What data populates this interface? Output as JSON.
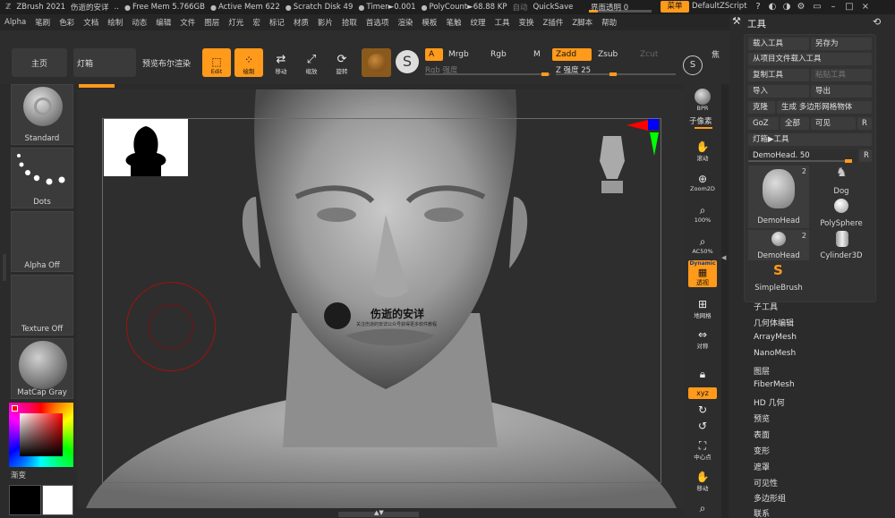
{
  "titlebar": {
    "app": "ZBrush 2021",
    "doc": "伤逝的安详",
    "ellipsis": "..",
    "free_mem": "Free Mem 5.766GB",
    "active_mem": "Active Mem 622",
    "scratch": "Scratch Disk 49",
    "timer": "Timer►0.001",
    "polycount": "PolyCount►68.88 KP",
    "auto": "自动",
    "quicksave": "QuickSave",
    "ui_transparency": "界面透明 0",
    "menu_btn": "菜单",
    "script": "DefaultZScript"
  },
  "menus": [
    "Alpha",
    "笔刷",
    "色彩",
    "文档",
    "绘制",
    "动态",
    "编辑",
    "文件",
    "图层",
    "灯光",
    "宏",
    "标记",
    "材质",
    "影片",
    "拾取",
    "首选项",
    "渲染",
    "模板",
    "笔触",
    "纹理",
    "工具",
    "变换",
    "Z插件",
    "Z脚本",
    "帮助"
  ],
  "toolbar": {
    "home": "主页",
    "lightbox": "灯箱",
    "bpr": "预览布尔渲染",
    "edit": "Edit",
    "draw": "绘制",
    "move": "移动",
    "scale": "缩放",
    "rotate": "旋转",
    "a": "A",
    "mrgb": "Mrgb",
    "rgb": "Rgb",
    "m": "M",
    "rgb_intensity": "Rgb 强度",
    "zadd": "Zadd",
    "zsub": "Zsub",
    "zcut": "Zcut",
    "z_intensity": "Z 强度 25",
    "focal": "焦"
  },
  "left_shelf": {
    "brush": "Standard",
    "stroke": "Dots",
    "alpha": "Alpha Off",
    "texture": "Texture Off",
    "material": "MatCap Gray",
    "gradient": "渐变"
  },
  "right_col": {
    "bpr": "BPR",
    "subpixel": "子像素",
    "scroll": "滚动",
    "zoom2d": "Zoom2D",
    "actual": "100%",
    "half": "AC50%",
    "dynamic": "Dynamic",
    "persp": "透视",
    "floor": "地网格",
    "local": "对称",
    "xyz": "xyz",
    "frame": "中心点",
    "move": "移动"
  },
  "watermark": {
    "title": "伤逝的安详",
    "sub": "关注伤逝的安详公众号获得更多软件教程"
  },
  "panel": {
    "title": "工具",
    "buttons": {
      "load": "载入工具",
      "save_as": "另存为",
      "load_from_project": "从项目文件载入工具",
      "copy": "复制工具",
      "paste": "粘贴工具",
      "import": "导入",
      "export": "导出",
      "clone": "克隆",
      "make_polymesh": "生成 多边形网格物体",
      "goz": "GoZ",
      "all": "全部",
      "visible": "可见",
      "r": "R",
      "lightbox_tools": "灯箱▶工具",
      "current_tool": "DemoHead. 50"
    },
    "tiles": {
      "demohead1": "DemoHead",
      "dog": "Dog",
      "polysphere": "PolySphere",
      "demohead2": "DemoHead",
      "cylinder": "Cylinder3D",
      "simplebrush": "SimpleBrush",
      "count1": "2",
      "count2": "2"
    },
    "sections": [
      "子工具",
      "几何体编辑",
      "ArrayMesh",
      "NanoMesh",
      "图层",
      "FiberMesh",
      "HD 几何",
      "预览",
      "表面",
      "变形",
      "遮罩",
      "可见性",
      "多边形组",
      "联系"
    ]
  }
}
